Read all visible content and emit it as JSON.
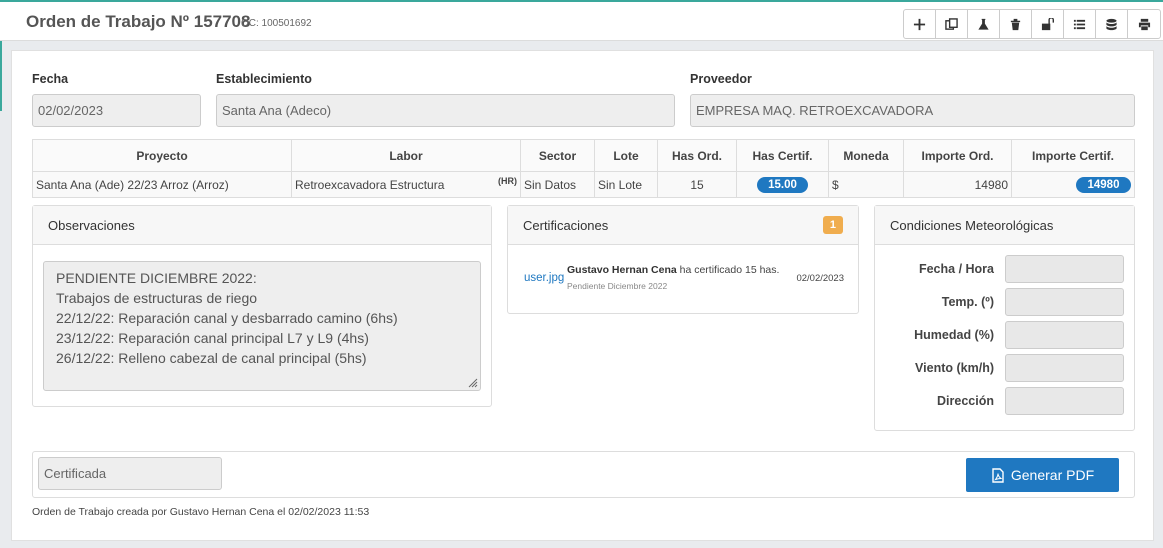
{
  "header": {
    "title": "Orden de Trabajo Nº 157708",
    "oc": "OC: 100501692",
    "toolbar": [
      "plus-icon",
      "copy-icon",
      "flask-icon",
      "trash-icon",
      "unlock-icon",
      "list-icon",
      "database-icon",
      "print-icon"
    ]
  },
  "form": {
    "fecha_label": "Fecha",
    "fecha_value": "02/02/2023",
    "establecimiento_label": "Establecimiento",
    "establecimiento_value": "Santa Ana (Adeco)",
    "proveedor_label": "Proveedor",
    "proveedor_value": "EMPRESA MAQ. RETROEXCAVADORA"
  },
  "table": {
    "headers": [
      "Proyecto",
      "Labor",
      "Sector",
      "Lote",
      "Has Ord.",
      "Has Certif.",
      "Moneda",
      "Importe Ord.",
      "Importe Certif."
    ],
    "row": {
      "proyecto": "Santa Ana (Ade) 22/23 Arroz (Arroz)",
      "labor": "Retroexcavadora Estructura",
      "labor_tag": "(HR)",
      "sector": "Sin Datos",
      "lote": "Sin Lote",
      "has_ord": "15",
      "has_certif": "15.00",
      "moneda": "$",
      "importe_ord": "14980",
      "importe_certif": "14980"
    }
  },
  "observaciones": {
    "title": "Observaciones",
    "lines": [
      "PENDIENTE DICIEMBRE 2022:",
      "Trabajos de estructuras de riego",
      "22/12/22: Reparación canal y desbarrado camino (6hs)",
      "23/12/22: Reparación canal principal L7 y L9 (4hs)",
      "26/12/22: Relleno cabezal de canal principal (5hs)"
    ]
  },
  "certificaciones": {
    "title": "Certificaciones",
    "count": "1",
    "item": {
      "file": "user.jpg",
      "user": "Gustavo Hernan Cena",
      "action": " ha certificado 15 has.",
      "note": "Pendiente Diciembre 2022",
      "date": "02/02/2023"
    }
  },
  "meteo": {
    "title": "Condiciones Meteorológicas",
    "fields": [
      "Fecha / Hora",
      "Temp. (º)",
      "Humedad (%)",
      "Viento (km/h)",
      "Dirección"
    ]
  },
  "footer": {
    "status": "Certificada",
    "pdf_button": "Generar PDF",
    "created": "Orden de Trabajo creada por Gustavo Hernan Cena el 02/02/2023 11:53"
  },
  "colors": {
    "accent": "#3aa89c",
    "primary": "#1f78c1",
    "badge": "#f0ad4e"
  }
}
